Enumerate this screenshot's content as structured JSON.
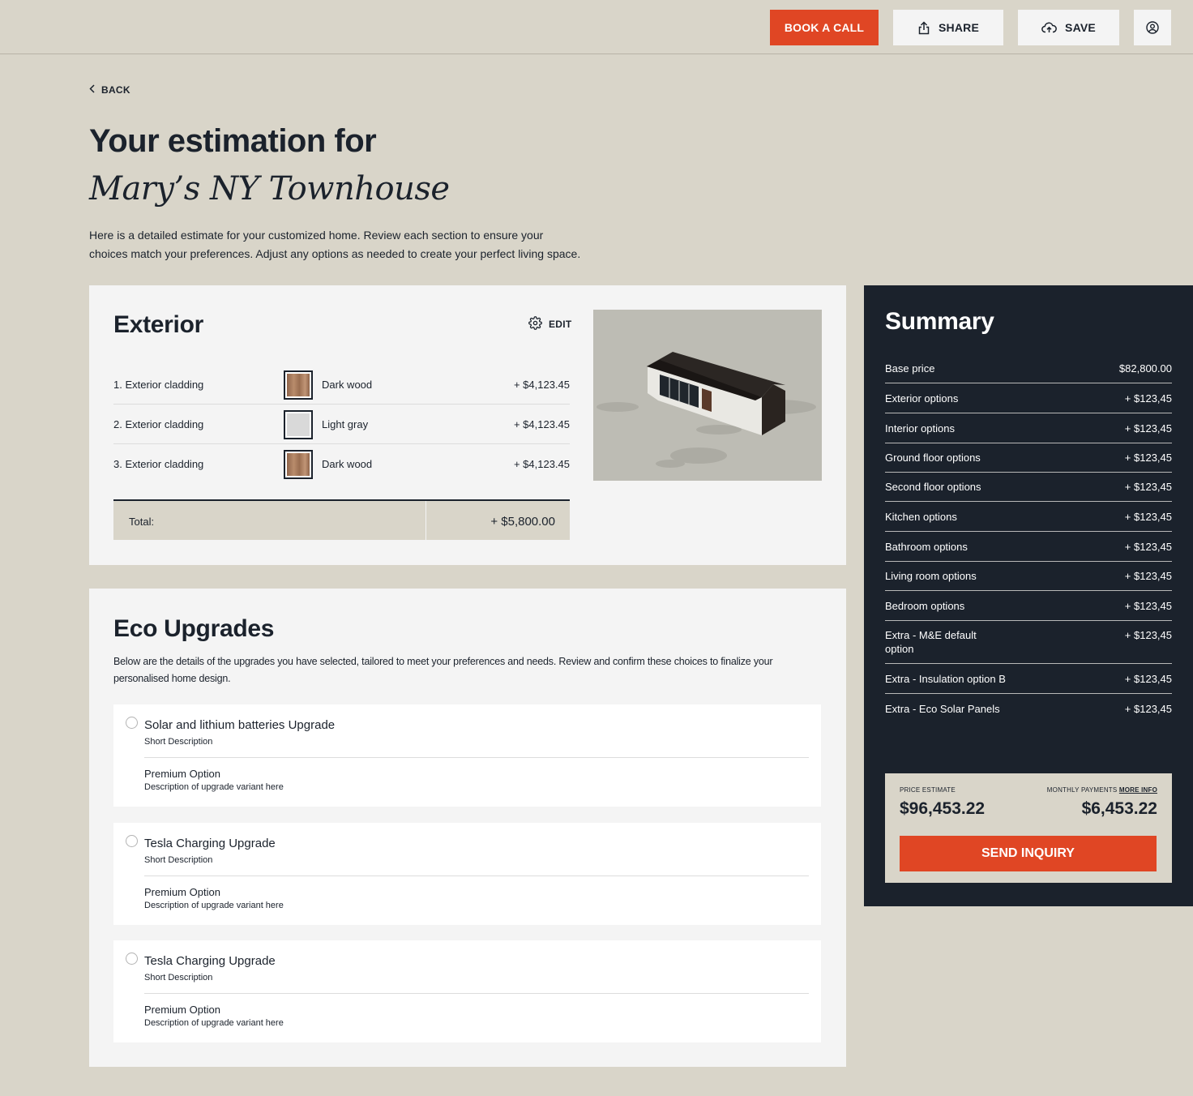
{
  "header": {
    "book_call": "BOOK A CALL",
    "share": "SHARE",
    "save": "SAVE",
    "user_icon": "user-circle-icon"
  },
  "back": "BACK",
  "title_line1": "Your estimation for",
  "title_line2": "Mary’s NY Townhouse",
  "intro": "Here is a detailed estimate for your customized home. Review each section to ensure your choices match your preferences. Adjust any options as needed to create your perfect living space.",
  "exterior": {
    "title": "Exterior",
    "edit": "EDIT",
    "rows": [
      {
        "label": "1. Exterior cladding",
        "material": "Dark wood",
        "price": "+ $4,123.45",
        "swatch": "#a07457"
      },
      {
        "label": "2. Exterior cladding",
        "material": "Light gray",
        "price": "+ $4,123.45",
        "swatch": "#d9d9d9"
      },
      {
        "label": "3. Exterior cladding",
        "material": "Dark wood",
        "price": "+ $4,123.45",
        "swatch": "#a07457"
      }
    ],
    "total_label": "Total:",
    "total_value": "+ $5,800.00"
  },
  "eco": {
    "title": "Eco Upgrades",
    "description": "Below are the details of the upgrades you have selected, tailored to meet your preferences and needs. Review and confirm these choices to finalize your personalised home design.",
    "items": [
      {
        "title": "Solar and lithium batteries Upgrade",
        "short": "Short Description",
        "option": "Premium Option",
        "option_desc": "Description of upgrade variant here"
      },
      {
        "title": "Tesla Charging Upgrade",
        "short": "Short Description",
        "option": "Premium Option",
        "option_desc": "Description of upgrade variant here"
      },
      {
        "title": "Tesla Charging Upgrade",
        "short": "Short Description",
        "option": "Premium Option",
        "option_desc": "Description of upgrade variant here"
      }
    ]
  },
  "summary": {
    "title": "Summary",
    "rows": [
      {
        "label": "Base price",
        "value": "$82,800.00"
      },
      {
        "label": "Exterior options",
        "value": "+ $123,45"
      },
      {
        "label": "Interior options",
        "value": "+ $123,45"
      },
      {
        "label": "Ground floor options",
        "value": "+ $123,45"
      },
      {
        "label": "Second floor options",
        "value": "+ $123,45"
      },
      {
        "label": "Kitchen options",
        "value": "+ $123,45"
      },
      {
        "label": "Bathroom options",
        "value": "+ $123,45"
      },
      {
        "label": "Living room options",
        "value": "+ $123,45"
      },
      {
        "label": "Bedroom options",
        "value": "+ $123,45"
      },
      {
        "label": "Extra - M&E default option",
        "value": "+ $123,45"
      },
      {
        "label": "Extra - Insulation option B",
        "value": "+ $123,45"
      },
      {
        "label": "Extra - Eco Solar Panels",
        "value": "+ $123,45"
      }
    ],
    "price_estimate_label": "PRICE ESTIMATE",
    "price_estimate": "$96,453.22",
    "monthly_label": "MONTHLY PAYMENTS",
    "more_info": "MORE INFO",
    "monthly_value": "$6,453.22",
    "send": "SEND INQUIRY"
  },
  "colors": {
    "accent": "#e04624",
    "background": "#d9d5c9",
    "dark": "#1b222c",
    "card": "#f4f4f4"
  }
}
